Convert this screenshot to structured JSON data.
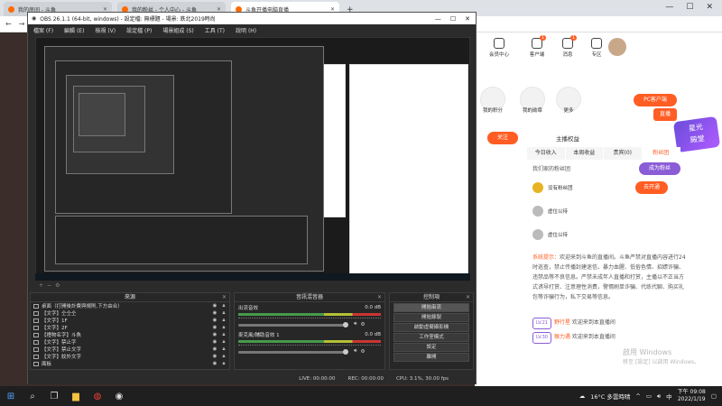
{
  "browser": {
    "tabs": [
      {
        "label": "我的房间 - 斗鱼",
        "active": false
      },
      {
        "label": "我的粉丝 - 个人中心 - 斗鱼",
        "active": false
      },
      {
        "label": "斗鱼开播电脑直播",
        "active": true
      }
    ]
  },
  "page": {
    "top_icons": [
      {
        "label": "会员中心",
        "badge": ""
      },
      {
        "label": "客户端",
        "badge": "1"
      },
      {
        "label": "消息",
        "badge": "1"
      },
      {
        "label": "专区",
        "badge": ""
      }
    ],
    "row_icons": [
      "我的积分",
      "我的勋章",
      "更多"
    ],
    "pc_button": "PC客户端",
    "live_button": "直播",
    "follow_button": "关注",
    "host_label": "主播权益",
    "tabs": [
      "今日收入",
      "本周收益",
      "贵宾(0)",
      "粉丝团"
    ],
    "rank_title": "我们家的粉丝团",
    "rank_link": "成为粉丝",
    "rank_rows": [
      {
        "name": "没有粉丝团",
        "btn": "去开通"
      },
      {
        "name": "虚位以待",
        "btn": ""
      },
      {
        "name": "虚位以待",
        "btn": ""
      }
    ],
    "system_label": "系统提示：",
    "system_text": "欢迎来到斗鱼的直播间。斗鱼严禁对直播内容进行24时巡查，禁止传播封建迷信、暴力血腥、低俗色情、招嫖诈骗、违禁品等不良信息。严禁未成年人直播和打赏，主播以不正当方式诱导打赏、注意理性消费，警惕刷单诈骗、代练代聊、购买礼包等诈骗行为，私下交易等信息。",
    "chat_lines": [
      {
        "level": "LV.21",
        "user": "野行星",
        "text": "欢迎来到本直播间"
      },
      {
        "level": "LV.30",
        "user": "猴力遇",
        "text": "欢迎来到本直播间"
      }
    ],
    "activation": [
      "啟用 Windows",
      "移至 [設定] 以啟用 Windows。"
    ],
    "star_logo": [
      "星光",
      "殿堂"
    ]
  },
  "obs": {
    "title": "OBS 26.1.1 (64-bit, windows) - 設定檔: 無標題 - 場景: 鉄北2019時尚",
    "menu": [
      "檔案 (F)",
      "編輯 (E)",
      "檢視 (V)",
      "設定檔 (P)",
      "場景組成 (S)",
      "工具 (T)",
      "說明 (H)"
    ],
    "docks": {
      "sources_title": "來源",
      "mixer_title": "音訊混音器",
      "controls_title": "控制項"
    },
    "sources": [
      "桌面（打開後計費與規則,下方由合）",
      "【文字】仝仝仝",
      "【文字】1F",
      "【文字】2F",
      "【禮物名字】斗魚",
      "【文字】禁止字",
      "【文字】禁止文字",
      "【文字】紋外文字",
      "面板"
    ],
    "mixer": [
      {
        "name": "出流音效",
        "db": "0.0 dB"
      },
      {
        "name": "麥克風/輔助音效 1",
        "db": "0.0 dB"
      }
    ],
    "controls": [
      "開始串流",
      "開始錄製",
      "啟動虛擬攝影機",
      "工作室模式",
      "設定",
      "離開"
    ],
    "status": {
      "live": "LIVE: 00:00:00",
      "rec": "REC: 00:00:00",
      "cpu": "CPU: 3.1%, 30.00 fps"
    }
  },
  "taskbar": {
    "weather": "16°C 多雲時晴",
    "ime": "中",
    "time": "下午 09:08",
    "date": "2022/1/19"
  },
  "colors": {
    "accent": "#ff5d23",
    "obs_bg": "#2b2b2b",
    "taskbar": "#1f1f1f"
  }
}
